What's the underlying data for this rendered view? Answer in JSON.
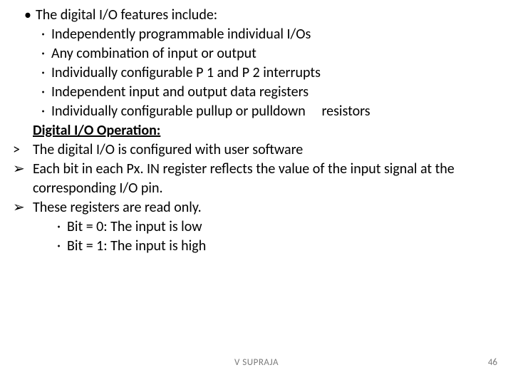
{
  "bullets": {
    "dot": "•",
    "middot": "·",
    "angle": ">",
    "arrow": "➢"
  },
  "lines": {
    "features_intro": "The digital I/O features include:",
    "f1": "Independently programmable individual I/Os",
    "f2": "Any combination of input or output",
    "f3": "Individually configurable P 1 and P 2 interrupts",
    "f4": "Independent input and output data registers",
    "f5a": "Individually configurable pullup or pulldown",
    "f5b": "resistors",
    "heading": "Digital I/O Operation:",
    "op1": "The digital I/O is configured with user software",
    "op2": "Each bit in each Px. IN register reflects the value of the input signal at the corresponding I/O pin.",
    "op3": "These registers are read only.",
    "b0": "Bit = 0: The input is low",
    "b1": "Bit = 1: The input is high"
  },
  "footer": {
    "author": "V SUPRAJA",
    "page": "46"
  }
}
